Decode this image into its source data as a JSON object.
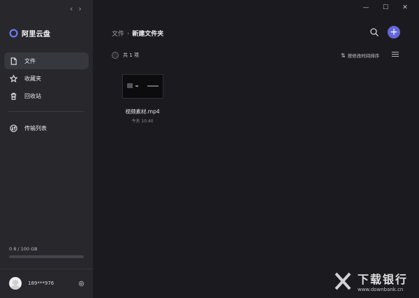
{
  "window": {
    "back": "‹",
    "forward": "›",
    "minimize": "—",
    "maximize": "☐",
    "close": "✕"
  },
  "brand": {
    "name": "阿里云盘"
  },
  "nav": {
    "items": [
      {
        "label": "文件",
        "icon": "file-icon",
        "active": true
      },
      {
        "label": "收藏夹",
        "icon": "star-icon"
      },
      {
        "label": "回收站",
        "icon": "trash-icon"
      }
    ],
    "transfer": {
      "label": "传输列表",
      "icon": "transfer-icon"
    }
  },
  "storage": {
    "text": "0 8 / 100 GB",
    "used_fraction": 0.0
  },
  "user": {
    "name": "189***976"
  },
  "breadcrumb": {
    "root": "文件",
    "separator": "›",
    "current": "新建文件夹"
  },
  "toolbar": {
    "count": "共 1 项",
    "sort_label": "按修改时间排序",
    "sort_icon": "⇅"
  },
  "add_button": {
    "label": "+"
  },
  "files": [
    {
      "name": "视频素材.mp4",
      "date": "今天 10:40"
    }
  ],
  "watermark": {
    "title": "下载银行",
    "url": "www.downbank.cn"
  },
  "colors": {
    "accent": "#6366d9",
    "sidebar": "#27272c",
    "main": "#1b1b1f"
  }
}
